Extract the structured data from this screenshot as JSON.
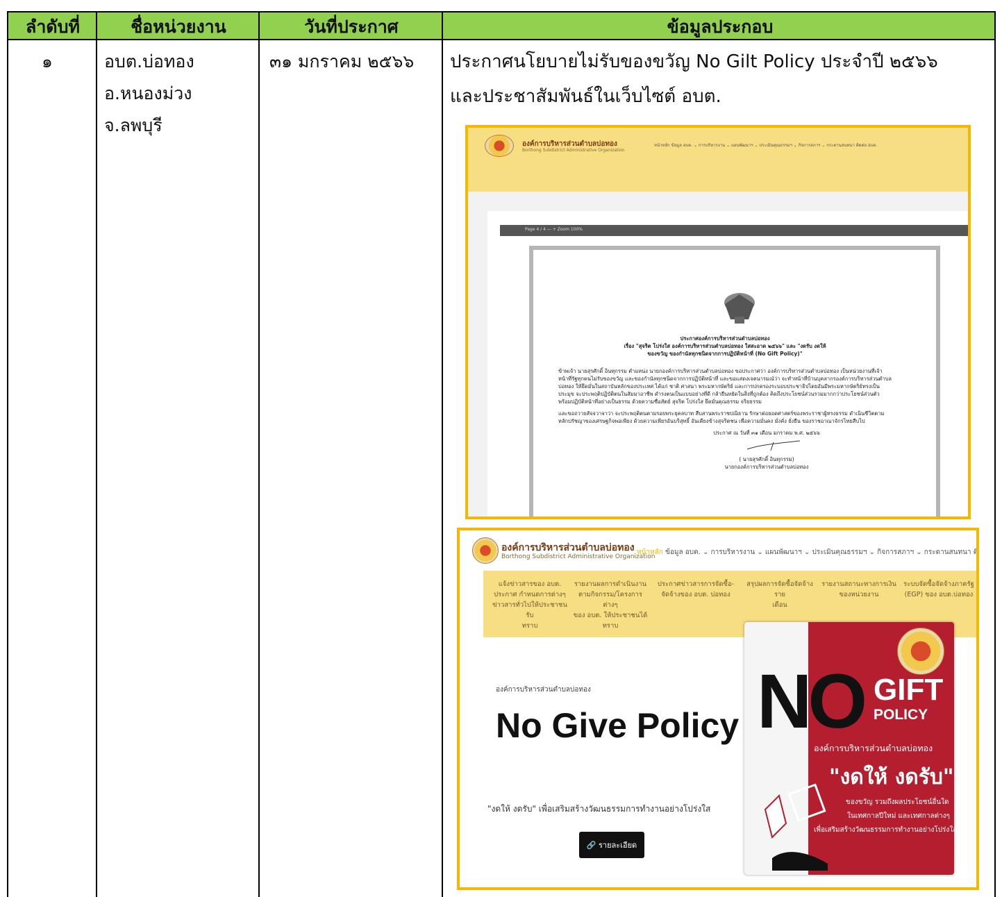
{
  "table": {
    "headers": [
      "ลำดับที่",
      "ชื่อหน่วยงาน",
      "วันที่ประกาศ",
      "ข้อมูลประกอบ"
    ],
    "row": {
      "number": "๑",
      "agency": [
        "อบต.บ่อทอง",
        "อ.หนองม่วง",
        "จ.ลพบุรี"
      ],
      "date": "๓๑ มกราคม ๒๕๖๖",
      "details": [
        "ประกาศนโยบายไม่รับของขวัญ No Gilt Policy ประจำปี ๒๕๖๖",
        "และประชาสัมพันธ์ในเว็บไซต์ อบต."
      ]
    }
  },
  "colors": {
    "header_bg": "#92d050",
    "highlight_border": "#f5b800",
    "site_yellow": "#f8de82",
    "poster_red": "#b41e2e"
  },
  "screenshot1": {
    "site_title": "องค์การบริหารส่วนตำบลบ่อทอง",
    "site_subtitle": "Borthong Subdistrict Administrative Organization",
    "nav": "หน้าหลัก  ข้อมูล อบต. ⌄  การบริหารงาน ⌄  แผนพัฒนาฯ ⌄  ประเมินคุณธรรมฯ ⌄  กิจการสภาฯ ⌄  กระดานสนทนา  ติดต่อ อบต.",
    "pdf_toolbar": "Page 4 / 4     —   +   Zoom 100%",
    "doc": {
      "heading": "ประกาศองค์การบริหารส่วนตำบลบ่อทอง",
      "subject1": "เรื่อง \"สุจริต โปร่งใส องค์การบริหารส่วนตำบลบ่อทอง ใสสะอาด ๒๕๖๖\" และ \"งดรับ งดให้",
      "subject2": "ของขวัญ ของกำนัลทุกชนิดจากการปฏิบัติหน้าที่ (No Gift Policy)\"",
      "para1": "ข้าพเจ้า นายสุรศักดิ์ อินทุกรรม ตำแหน่ง นายกองค์การบริหารส่วนตำบลบ่อทอง ขอประกาศว่า องค์การบริหารส่วนตำบลบ่อทอง เป็นหน่วยงานที่เจ้าหน้าที่รัฐทุกคนไม่รับของขวัญ และของกำนัลทุกชนิดจากการปฏิบัติหน้าที่ และขอแสดงเจตนารมณ์ว่า จะทำหน้าที่บ้านบุคลากรองค์การบริหารส่วนตำบลบ่อทอง ให้ยึดมั่นในสถาบันหลักของประเทศ ได้แก่ ชาติ ศาสนา พระมหากษัตริย์ และการปกครองระบอบประชาธิปไตยอันมีพระมหากษัตริย์ทรงเป็นประมุข จะประพฤติปฏิบัติตนในสัมมาอาชีพ ดำรงตนเป็นแบบอย่างที่ดี กล้ายืนหยัดในสิ่งที่ถูกต้อง คิดถึงประโยชน์ส่วนรวมมากกว่าประโยชน์ส่วนตัว พร้อมปฏิบัติหน้าที่อย่างเป็นธรรม ด้วยความซื่อสัตย์ สุจริต โปร่งใส ยึดมั่นคุณธรรม จริยธรรม",
      "para2": "และขอถวายสัจจวาจาว่า จะประพฤติตนตามรอยพระยุคลบาท สืบสานพระราชปณิธาน รักษาต่อยอดศาสตร์ของพระราชาผู้ทรงธรรม ดำเนินชีวิตตามหลักปรัชญาของเศรษฐกิจพอเพียง ด้วยความเพียรอันบริสุทธิ์ อันเคียงข้างสุจริตชน เพื่อความมั่นคง มั่งคั่ง ยั่งยืน ของราชอาณาจักรไทยสืบไป",
      "announce": "ประกาศ  ณ  วันที่ ๓๑  เดือน มกราคม พ.ศ. ๒๕๖๖",
      "signer": "( นายสุรศักดิ์  อินทุกรรม)",
      "position": "นายกองค์การบริหารส่วนตำบลบ่อทอง"
    }
  },
  "screenshot2": {
    "site_title": "องค์การบริหารส่วนตำบลบ่อทอง",
    "site_subtitle": "Borthong Subdistrict Administrative Organization",
    "nav_home": "หน้าหลัก",
    "nav_rest": "ข้อมูล อบต. ⌄  การบริหารงาน ⌄  แผนพัฒนาฯ ⌄  ประเมินคุณธรรมฯ ⌄  กิจการสภาฯ ⌄  กระดานสนทนา  ติดต่อ อบต.  ค้นหา",
    "menu": [
      [
        "แจ้งข่าวสารของ อบต.",
        "ประกาศ กำหนดการต่างๆ",
        "ข่าวสารทั่วไปให้ประชาชนรับ",
        "ทราบ"
      ],
      [
        "รายงานผลการดำเนินงาน",
        "ตามกิจกรรม/โครงการต่างๆ",
        "ของ อบต. ให้ประชาชนได้",
        "ทราบ"
      ],
      [
        "ประกาศข่าวสารการจัดซื้อ-",
        "จัดจ้างของ อบต. บ่อทอง"
      ],
      [
        "สรุปผลการจัดซื้อจัดจ้างราย",
        "เดือน"
      ],
      [
        "รายงานสถานะทางการเงิน",
        "ของหน่วยงาน"
      ],
      [
        "ระบบจัดซื้อจัดจ้างภาครัฐ",
        "(EGP) ของ อบต.บ่อทอง"
      ]
    ],
    "org_small": "องค์การบริหารส่วนตำบลบ่อทอง",
    "headline": "No Give Policy",
    "slogan": "\"งดให้ งดรับ\" เพื่อเสริมสร้างวัฒนธรรมการทำงานอย่างโปร่งใส",
    "button": "🔗 รายละเอียด",
    "poster": {
      "no": "NO",
      "gift": "GIFT",
      "policy": "POLICY",
      "org": "องค์การบริหารส่วนตำบลบ่อทอง",
      "slogan": "\"งดให้ งดรับ\"",
      "line1": "ของขวัญ รวมถึงผลประโยชน์อื่นใด",
      "line2": "ในเทศกาลปีใหม่ และเทศกาลต่างๆ",
      "line3": "เพื่อเสริมสร้างวัฒนธรรมการทำงานอย่างโปร่งใส"
    }
  }
}
